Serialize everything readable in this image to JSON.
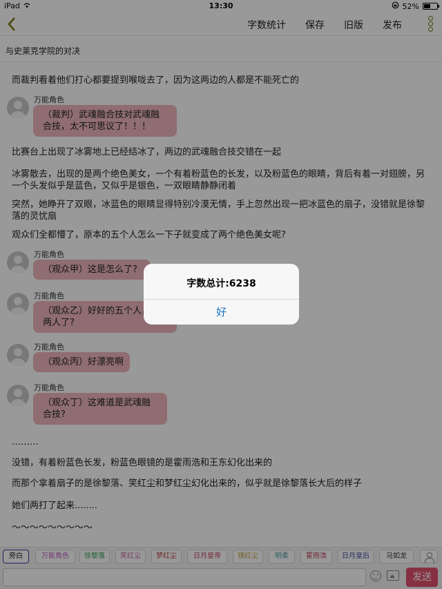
{
  "status": {
    "device": "iPad",
    "time": "13:30",
    "battery": "52%",
    "battery_level": 0.52
  },
  "nav": {
    "word_count_label": "字数统计",
    "save_label": "保存",
    "old_version_label": "旧版",
    "publish_label": "发布"
  },
  "doc_title": "与史莱克学院的对决",
  "content": {
    "p1": "而裁判看着他们打心都要提到喉咙去了，因为这两边的人都是不能死亡的",
    "d1": {
      "role": "万能角色",
      "text": "（裁判）武魂融合技对武魂融合技，太不可思议了！！！"
    },
    "p2": "比赛台上出现了冰雾地上已经结冰了，两边的武魂融合技交错在一起",
    "p3": "冰雾散去，出现的是两个绝色美女，一个有着粉蓝色的长发，以及粉蓝色的眼睛，背后有着一对翅膀，另一个头发似乎是蓝色，又似乎是银色，一双眼睛静静闭着",
    "p4": "突然，她睁开了双眼，冰蓝色的眼睛显得特别冷漠无情，手上忽然出现一把冰蓝色的扇子，没错就是徐黎落的灵忧扇",
    "p5": "观众们全都懵了，原本的五个人怎么一下子就变成了两个绝色美女呢?",
    "d2": {
      "role": "万能角色",
      "text": "（观众甲）这是怎么了?"
    },
    "d3": {
      "role": "万能角色",
      "text": "（观众乙）好好的五个人，成两人了?"
    },
    "d4": {
      "role": "万能角色",
      "text": "（观众丙）好漂亮啊"
    },
    "d5": {
      "role": "万能角色",
      "text": "（观众丁）这难道是武魂融合技?"
    },
    "p6": "………",
    "p7": "没错，有着粉蓝色长发，粉蓝色眼镜的是霍雨浩和王东幻化出来的",
    "p8": "而那个拿着扇子的是徐黎落、笑红尘和梦红尘幻化出来的，似乎就是徐黎落长大后的样子",
    "p9": "她们两打了起来........",
    "p10": "～～～～～～～～～"
  },
  "tags": [
    {
      "label": "旁白",
      "color": "#222222"
    },
    {
      "label": "万能角色",
      "color": "#c060c0"
    },
    {
      "label": "徐黎落",
      "color": "#3aa060"
    },
    {
      "label": "笑红尘",
      "color": "#c060a0"
    },
    {
      "label": "梦红尘",
      "color": "#c04040"
    },
    {
      "label": "日月皇帝",
      "color": "#c04060"
    },
    {
      "label": "镜红尘",
      "color": "#c0a040"
    },
    {
      "label": "明柔",
      "color": "#50a0a0"
    },
    {
      "label": "霍雨浩",
      "color": "#c04060"
    },
    {
      "label": "日月皇后",
      "color": "#4050a0"
    },
    {
      "label": "马如龙",
      "color": "#333333"
    }
  ],
  "input": {
    "placeholder": "",
    "send_label": "发送"
  },
  "alert": {
    "message": "字数总计:6238",
    "ok_label": "好"
  }
}
